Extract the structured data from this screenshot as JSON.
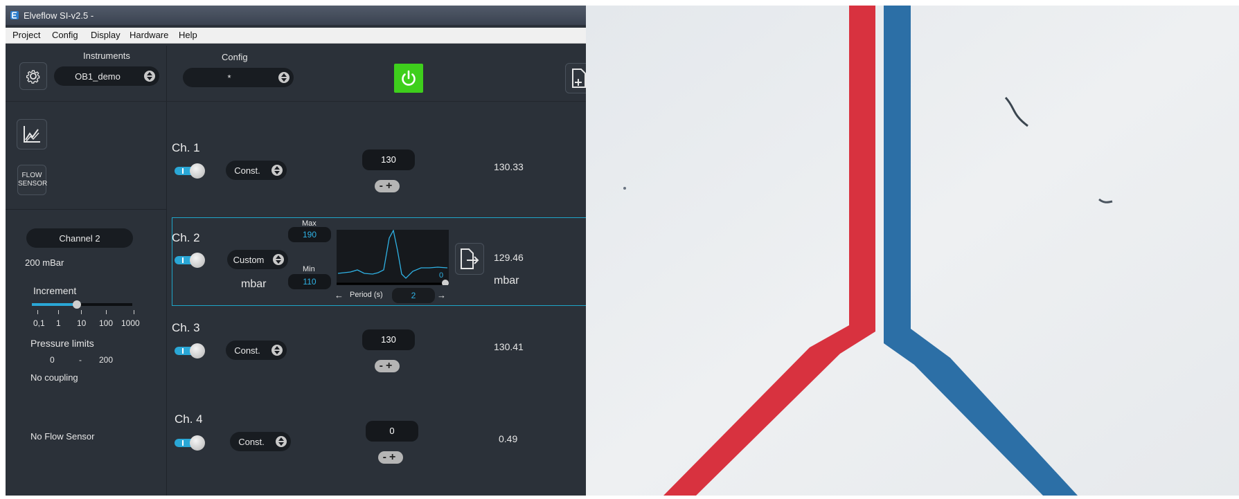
{
  "window": {
    "title": "Elveflow SI-v2.5  -"
  },
  "menu": [
    "Project",
    "Config",
    "Display",
    "Hardware",
    "Help"
  ],
  "topbar": {
    "instruments_label": "Instruments",
    "instrument_value": "OB1_demo",
    "config_label": "Config",
    "config_value": "*",
    "power_color": "#3ecf1c"
  },
  "sidebar": {
    "flow_sensor_button": [
      "FLOW",
      "SENSOR"
    ],
    "channel_button": "Channel 2",
    "range": "200 mBar",
    "increment_label": "Increment",
    "increment_ticks": [
      "0,1",
      "1",
      "10",
      "100",
      "1000"
    ],
    "increment_level": 0.45,
    "pressure_limits_label": "Pressure limits",
    "limit_min": "0",
    "limit_sep": "-",
    "limit_max": "200",
    "coupling": "No coupling",
    "flow_sensor_status": "No Flow Sensor"
  },
  "channels": [
    {
      "label": "Ch. 1",
      "mode": "Const.",
      "setpoint": "130",
      "reading": "130.33"
    },
    {
      "label": "Ch. 2",
      "mode": "Custom",
      "unit": "mbar",
      "max_label": "Max",
      "max_value": "190",
      "min_label": "Min",
      "min_value": "110",
      "period_label": "Period (s)",
      "period_value": "2",
      "graph_zero": "0",
      "reading": "129.46",
      "reading_unit": "mbar"
    },
    {
      "label": "Ch. 3",
      "mode": "Const.",
      "setpoint": "130",
      "reading": "130.41"
    },
    {
      "label": "Ch. 4",
      "mode": "Const.",
      "setpoint": "0",
      "reading": "0.49"
    }
  ],
  "colors": {
    "panel_bg": "#2b3139",
    "toggle_on": "#2aa7d6",
    "highlight": "#1ea6c9",
    "red_channel": "#d8323f",
    "blue_channel": "#2c6fa6"
  }
}
